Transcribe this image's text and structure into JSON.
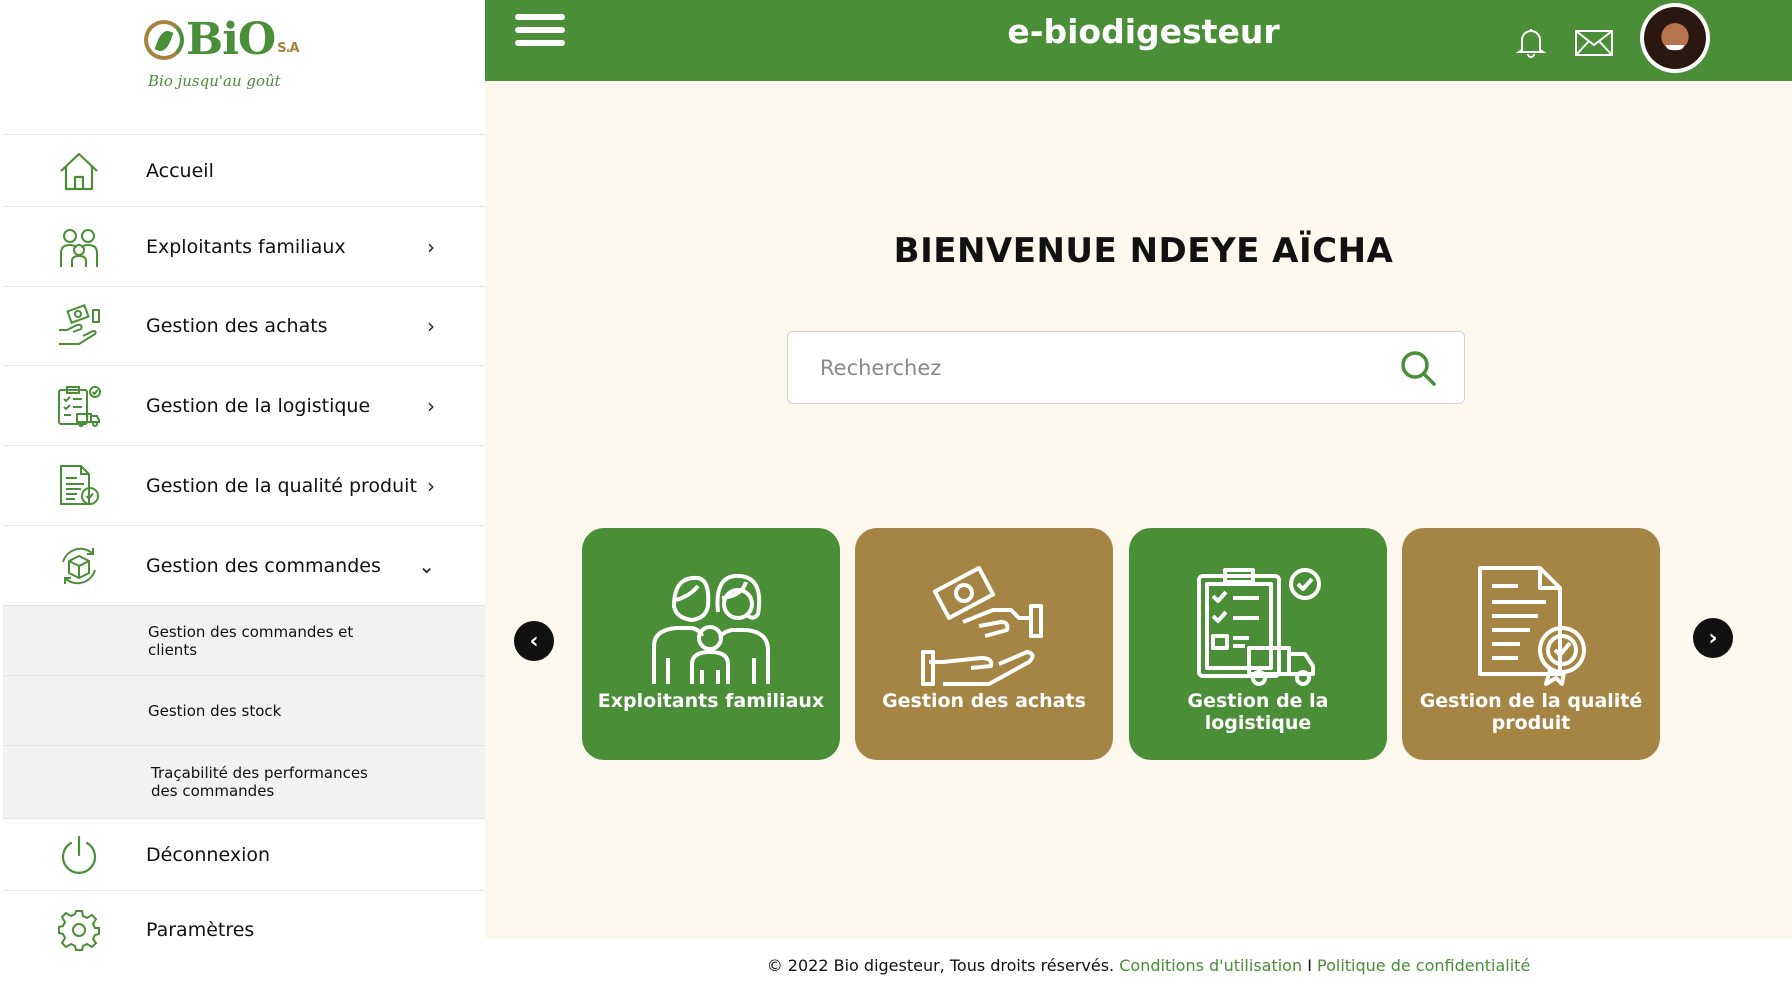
{
  "brand": {
    "logo_text": "BiO",
    "logo_suffix": "S.A",
    "tagline": "Bio jusqu'au goût",
    "colors": {
      "primary": "#4a8e38",
      "secondary": "#a58543",
      "background": "#fcf8ee"
    }
  },
  "sidebar": {
    "items": [
      {
        "label": "Accueil",
        "icon": "home-icon"
      },
      {
        "label": "Exploitants familiaux",
        "icon": "family-icon",
        "chevron": "›"
      },
      {
        "label": "Gestion des achats",
        "icon": "handshake-money-icon",
        "chevron": "›"
      },
      {
        "label": "Gestion de la logistique",
        "icon": "clipboard-truck-icon",
        "chevron": "›"
      },
      {
        "label": "Gestion de la qualité produit",
        "icon": "certificate-icon",
        "chevron": "›"
      },
      {
        "label": "Gestion des commandes",
        "icon": "box-cycle-icon",
        "chevron": "⌄"
      }
    ],
    "subitems": [
      {
        "label": "Gestion des commandes et clients"
      },
      {
        "label": "Gestion des stock"
      },
      {
        "label": "Traçabilité des performances des commandes"
      }
    ],
    "bottom": [
      {
        "label": "Déconnexion",
        "icon": "power-icon"
      },
      {
        "label": "Paramètres",
        "icon": "gear-icon"
      }
    ]
  },
  "header": {
    "title": "e-biodigesteur",
    "icons": [
      "menu-icon",
      "bell-icon",
      "mail-icon",
      "avatar"
    ]
  },
  "main": {
    "welcome": "BIENVENUE NDEYE AÏCHA",
    "search": {
      "placeholder": "Recherchez",
      "value": ""
    },
    "carousel": {
      "prev": "‹",
      "next": "›",
      "cards": [
        {
          "label": "Exploitants familiaux",
          "color": "green",
          "icon": "family-icon"
        },
        {
          "label": "Gestion des achats",
          "color": "brown",
          "icon": "handshake-money-icon"
        },
        {
          "label": "Gestion de la logistique",
          "color": "green",
          "icon": "clipboard-truck-icon"
        },
        {
          "label": "Gestion de la qualité produit",
          "color": "brown",
          "icon": "certificate-icon"
        }
      ]
    }
  },
  "footer": {
    "copyright": "© 2022 Bio digesteur, Tous droits réservés.",
    "terms": "Conditions d'utilisation",
    "separator": "I",
    "privacy": "Politique de confidentialité"
  }
}
